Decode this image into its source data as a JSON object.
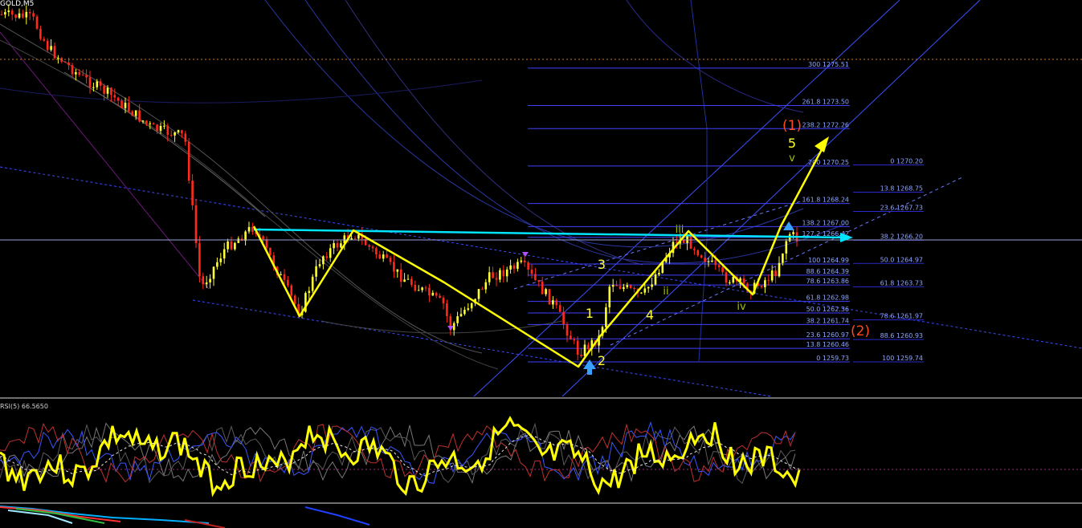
{
  "window": {
    "symbol": "GOLD,M5"
  },
  "colors": {
    "background": "#000000",
    "candle_up": "#ffff33",
    "candle_down": "#ff2a1a",
    "wave_lines": "#ffff00",
    "neckline": "#00e5ff",
    "fib_levels": "#4040ff",
    "fib_text": "#8ea7ff",
    "wave_label_major": "#ff4a1a",
    "wave_label_minor": "#a0c000",
    "rsi_line": "#ffff00",
    "rsi_ma": "#e0e0e0"
  },
  "fib_ext_left": [
    {
      "label": "300 1275.51"
    },
    {
      "label": "261.8 1273.50"
    },
    {
      "label": "238.2 1272.26"
    },
    {
      "label": "200 1270.25"
    },
    {
      "label": "161.8 1268.24"
    },
    {
      "label": "138.2 1267.00"
    },
    {
      "label": "127.2 1266.42"
    },
    {
      "label": "100 1264.99"
    },
    {
      "label": "88.6 1264.39"
    },
    {
      "label": "78.6 1263.86"
    },
    {
      "label": "61.8 1262.98"
    },
    {
      "label": "50.0 1262.36"
    },
    {
      "label": "38.2 1261.74"
    },
    {
      "label": "23.6 1260.97"
    },
    {
      "label": "13.8 1260.46"
    },
    {
      "label": "0 1259.73"
    }
  ],
  "fib_retr_right": [
    {
      "label": "0 1270.20"
    },
    {
      "label": "13.8 1268.75"
    },
    {
      "label": "23.6 1267.73"
    },
    {
      "label": "38.2 1266.20"
    },
    {
      "label": "50.0 1264.97"
    },
    {
      "label": "61.8 1263.73"
    },
    {
      "label": "78.6 1261.97"
    },
    {
      "label": "88.6 1260.93"
    },
    {
      "label": "100 1259.74"
    }
  ],
  "wave_labels": {
    "major": [
      {
        "text": "(1)"
      },
      {
        "text": "(2)"
      }
    ],
    "count": [
      {
        "text": "1"
      },
      {
        "text": "2"
      },
      {
        "text": "3"
      },
      {
        "text": "4"
      },
      {
        "text": "5"
      }
    ],
    "roman": [
      {
        "text": "ii"
      },
      {
        "text": "iii"
      },
      {
        "text": "iv"
      },
      {
        "text": "v"
      }
    ]
  },
  "rsi": {
    "label": "RSI(5) 66.5650"
  },
  "chart_data": {
    "type": "candlestick",
    "symbol": "GOLD",
    "timeframe": "M5",
    "y_range": [
      1259.0,
      1278.0
    ],
    "fibonacci_extension": [
      [
        300,
        1275.51
      ],
      [
        261.8,
        1273.5
      ],
      [
        238.2,
        1272.26
      ],
      [
        200,
        1270.25
      ],
      [
        161.8,
        1268.24
      ],
      [
        138.2,
        1267.0
      ],
      [
        127.2,
        1266.42
      ],
      [
        100,
        1264.99
      ],
      [
        88.6,
        1264.39
      ],
      [
        78.6,
        1263.86
      ],
      [
        61.8,
        1262.98
      ],
      [
        50.0,
        1262.36
      ],
      [
        38.2,
        1261.74
      ],
      [
        23.6,
        1260.97
      ],
      [
        13.8,
        1260.46
      ],
      [
        0,
        1259.73
      ]
    ],
    "fibonacci_retracement": [
      [
        0,
        1270.2
      ],
      [
        13.8,
        1268.75
      ],
      [
        23.6,
        1267.73
      ],
      [
        38.2,
        1266.2
      ],
      [
        50.0,
        1264.97
      ],
      [
        61.8,
        1263.73
      ],
      [
        78.6,
        1261.97
      ],
      [
        88.6,
        1260.93
      ],
      [
        100,
        1259.74
      ]
    ],
    "wave_counts": [
      "(1)",
      "(2)",
      "1",
      "2",
      "3",
      "4",
      "5",
      "ii",
      "iii",
      "iv",
      "v"
    ],
    "indicator": {
      "name": "RSI(5)",
      "value": 66.565
    }
  }
}
